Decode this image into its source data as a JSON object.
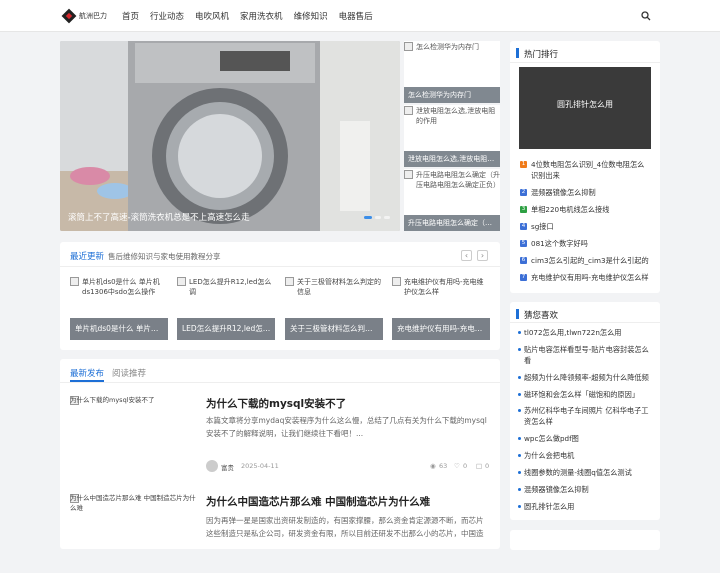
{
  "header": {
    "logo_text": "航洲巴力",
    "nav": [
      "首页",
      "行业动态",
      "电吹风机",
      "家用洗衣机",
      "维修知识",
      "电器售后"
    ]
  },
  "slider": {
    "caption": "滚筒上不了高速-滚筒洗衣机总是不上高速怎么走",
    "side": [
      {
        "alt": "怎么检测华为内存门",
        "caption": "怎么检测华为内存门"
      },
      {
        "alt": "泄放电阻怎么选,泄放电阻的作用",
        "caption": "泄放电阻怎么选,泄放电阻…"
      },
      {
        "alt": "升压电路电阻怎么确定（升压电路电阻怎么确定正负）",
        "caption": "升压电路电阻怎么确定（…"
      }
    ]
  },
  "latest": {
    "title": "最近更新",
    "subtitle": "售后维修知识与家电使用教程分享",
    "items": [
      {
        "alt": "单片机ds0是什么 单片机ds1306中sdo怎么操作",
        "caption": "单片机ds0是什么 单片…"
      },
      {
        "alt": "LED怎么提升R12,led怎么调",
        "caption": "LED怎么提升R12,led怎…"
      },
      {
        "alt": "关于三极管材料怎么判定的信息",
        "caption": "关于三极管材料怎么判…"
      },
      {
        "alt": "充电维护仪有用吗-充电维护仪怎么样",
        "caption": "充电维护仪有用吗-充电…"
      }
    ]
  },
  "tabs": [
    "最新发布",
    "阅读推荐"
  ],
  "articles": [
    {
      "thumb_alt": "为什么下载的mysql安装不了",
      "title": "为什么下载的mysql安装不了",
      "excerpt": "本篇文章将分享mydaq安装程序为什么这么慢，总结了几点有关为什么下载的mysql安装不了的解释说明，让我们继续往下看吧！...",
      "author": "富贵",
      "date": "2025-04-11",
      "views": "63",
      "likes": "0",
      "comments": "0"
    },
    {
      "thumb_alt": "为什么中国造芯片那么难 中国制造芯片为什么难",
      "title": "为什么中国造芯片那么难 中国制造芯片为什么难",
      "excerpt": "因为再弹一星是国家出资研发制造的，有国家撑腰，那么资金肯定源源不断，而芯片这些制造只是私企公司，研发资金有限，所以目前还研发不出那么小的芯片，中国造"
    }
  ],
  "hot": {
    "title": "热门排行",
    "image_caption": "圆孔排针怎么用",
    "items": [
      "4位数电阻怎么识别_4位数电阻怎么识别出来",
      "混频器镜像怎么抑制",
      "单相220电机线怎么接线",
      "sg接口",
      "081这个数字好吗",
      "cim3怎么引起的_cim3是什么引起的",
      "充电维护仪有用吗-充电维护仪怎么样"
    ],
    "rank_colors": [
      "#f07b1a",
      "#3c6fd6",
      "#2ea043",
      "#3c6fd6",
      "#3c6fd6",
      "#3c6fd6",
      "#3c6fd6"
    ]
  },
  "guess": {
    "title": "猜您喜欢",
    "items": [
      "tl072怎么用,tlwn722n怎么用",
      "贴片电容怎样看型号-贴片电容封装怎么看",
      "超频为什么降领频率-超频为什么降低频",
      "磁环饱和会怎么样「磁饱和的原因」",
      "苏州亿科华电子车间照片 亿科华电子工资怎么样",
      "wpc怎么做pdf图",
      "为什么会把电机",
      "线圈参数的测量-线圈q值怎么测试",
      "混频器镜像怎么抑制",
      "圆孔排针怎么用"
    ]
  }
}
